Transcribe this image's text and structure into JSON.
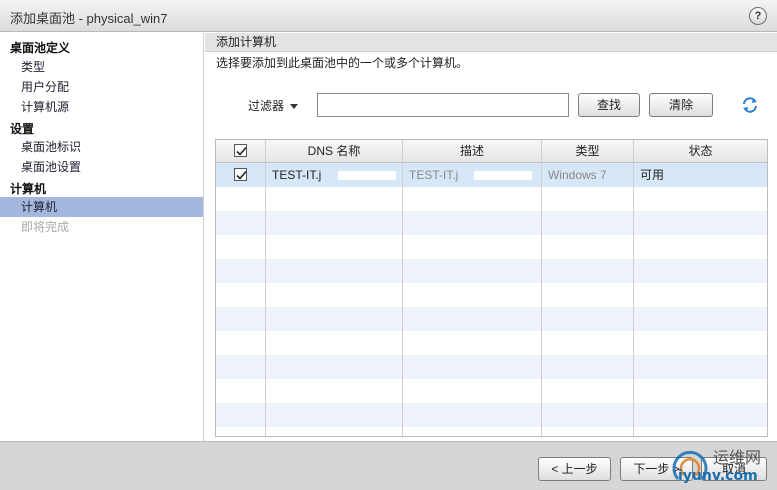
{
  "window": {
    "title": "添加桌面池 - physical_win7",
    "help": "?"
  },
  "sidebar": {
    "sections": [
      {
        "label": "桌面池定义",
        "items": [
          "类型",
          "用户分配",
          "计算机源"
        ]
      },
      {
        "label": "设置",
        "items": [
          "桌面池标识",
          "桌面池设置"
        ]
      },
      {
        "label": "计算机",
        "items": [
          "计算机",
          "即将完成"
        ]
      }
    ],
    "selected_item": "计算机",
    "disabled_item": "即将完成"
  },
  "main": {
    "section_title": "添加计算机",
    "description": "选择要添加到此桌面池中的一个或多个计算机。",
    "filter": {
      "label": "过滤器",
      "value": ""
    },
    "search_button": "查找",
    "clear_button": "清除",
    "table": {
      "columns": [
        "DNS 名称",
        "描述",
        "类型",
        "状态"
      ],
      "header_checked": true,
      "rows": [
        {
          "checked": true,
          "dns": "TEST-IT.j",
          "desc": "TEST-IT.j",
          "type": "Windows 7",
          "status": "可用"
        }
      ]
    }
  },
  "footer": {
    "back": "< 上一步",
    "next": "下一步 >",
    "cancel": "取消"
  },
  "watermark": {
    "text1": "运维网",
    "text2": "iyunv.com"
  },
  "icons": {
    "refresh": "refresh-icon",
    "check": "check-icon",
    "help": "help-icon"
  },
  "colors": {
    "selected_nav": "#a4b8de",
    "footer_bg": "#d6d6d6",
    "row_selected": "#d7e7f7"
  }
}
